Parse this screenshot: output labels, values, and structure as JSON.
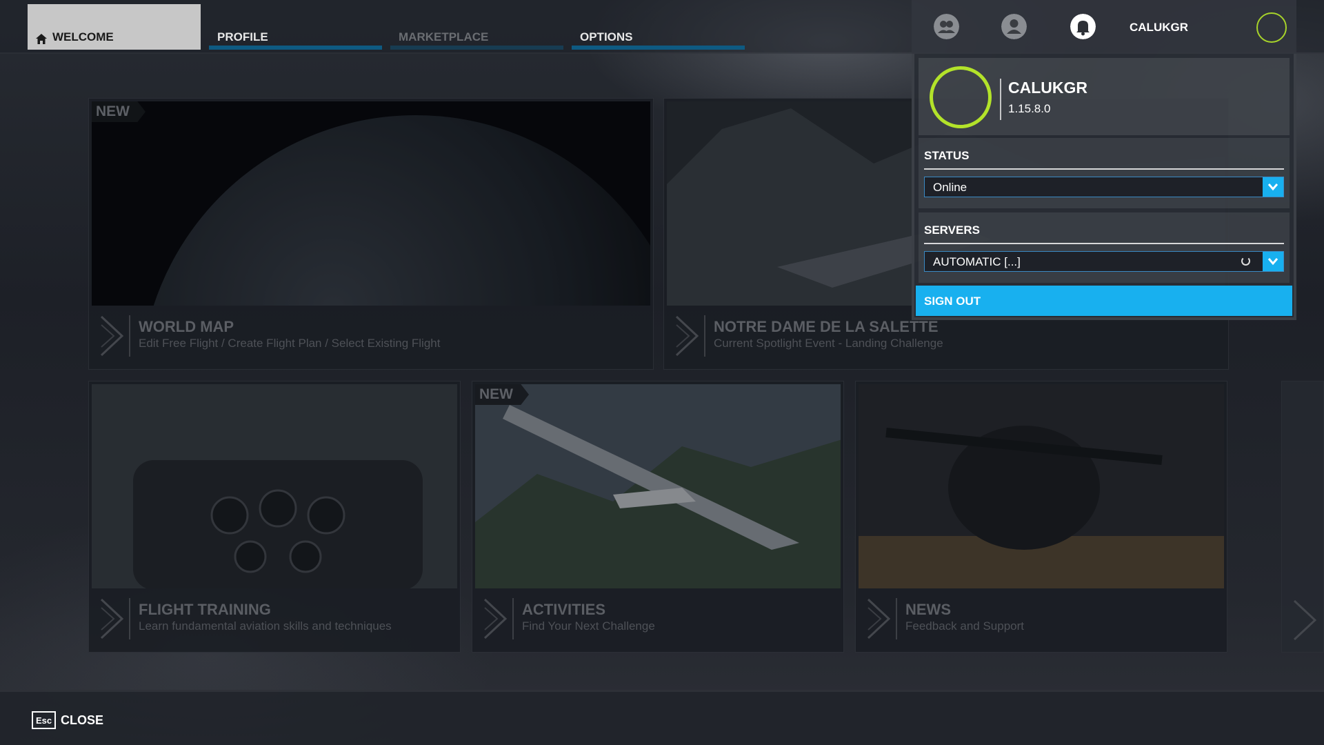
{
  "nav": {
    "tabs": [
      {
        "label": "WELCOME",
        "state": "active"
      },
      {
        "label": "PROFILE",
        "state": "normal"
      },
      {
        "label": "MARKETPLACE",
        "state": "disabled"
      },
      {
        "label": "OPTIONS",
        "state": "normal"
      }
    ]
  },
  "tiles": [
    {
      "title": "WORLD MAP",
      "subtitle": "Edit Free Flight / Create Flight Plan / Select Existing Flight",
      "badge": "NEW"
    },
    {
      "title": "NOTRE DAME DE LA SALETTE",
      "subtitle": "Current Spotlight Event - Landing Challenge"
    },
    {
      "title": "FLIGHT TRAINING",
      "subtitle": "Learn fundamental aviation skills and techniques"
    },
    {
      "title": "ACTIVITIES",
      "subtitle": "Find Your Next Challenge",
      "badge": "NEW"
    },
    {
      "title": "NEWS",
      "subtitle": "Feedback and Support"
    }
  ],
  "profile": {
    "username": "CALUKGR",
    "version": "1.15.8.0",
    "status_title": "STATUS",
    "status_value": "Online",
    "servers_title": "SERVERS",
    "servers_value": "AUTOMATIC [...]",
    "signout_label": "SIGN OUT",
    "accent": "#18b0ef",
    "avatar_ring": "#b3e32a"
  },
  "footer": {
    "key": "Esc",
    "label": "CLOSE"
  }
}
